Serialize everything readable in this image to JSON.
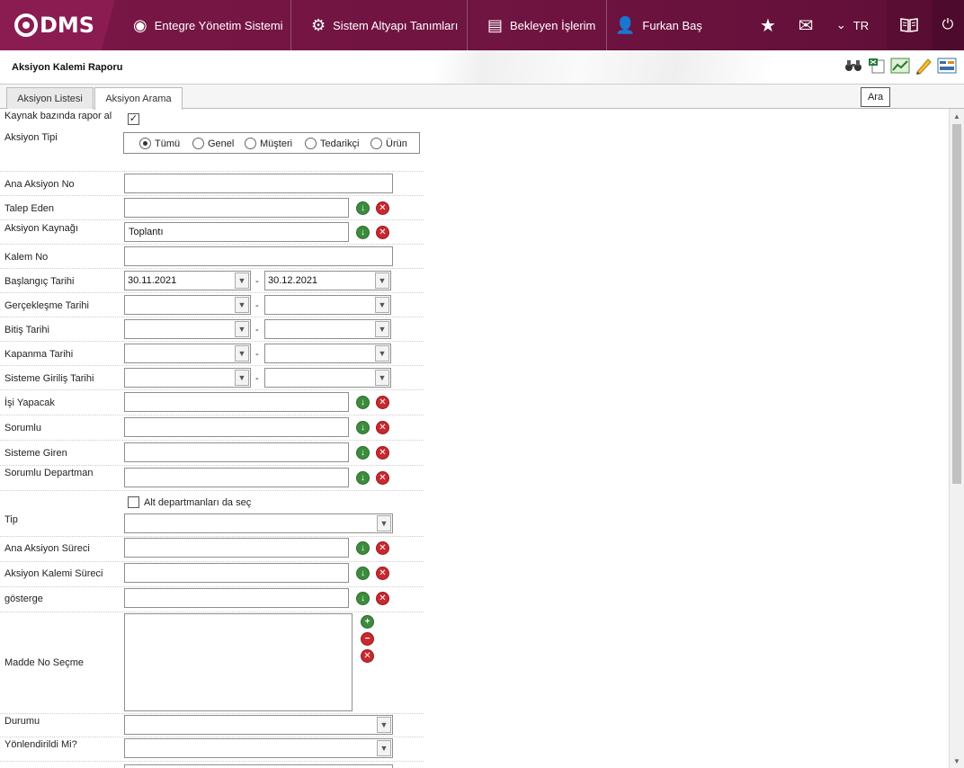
{
  "app": {
    "logo_text": "DMS",
    "nav": [
      {
        "label": "Entegre Yönetim Sistemi",
        "icon": "q-logo-icon"
      },
      {
        "label": "Sistem Altyapı Tanımları",
        "icon": "gear-icon"
      },
      {
        "label": "Bekleyen İşlerim",
        "icon": "clipboard-icon"
      },
      {
        "label": "Furkan Baş",
        "icon": "user-icon"
      }
    ],
    "language": "TR"
  },
  "page": {
    "title": "Aksiyon Kalemi Raporu",
    "tooltip": "Ara",
    "tabs": [
      {
        "label": "Aksiyon Listesi",
        "active": false
      },
      {
        "label": "Aksiyon Arama",
        "active": true
      }
    ]
  },
  "form": {
    "kaynak_bazinda": {
      "label": "Kaynak bazında rapor al",
      "checked": true
    },
    "aksiyon_tipi": {
      "label": "Aksiyon Tipi",
      "options": [
        "Tümü",
        "Genel",
        "Müşteri",
        "Tedarikçi",
        "Ürün"
      ],
      "selected": "Tümü"
    },
    "ana_aksiyon_no": {
      "label": "Ana Aksiyon No",
      "value": ""
    },
    "talep_eden": {
      "label": "Talep Eden",
      "value": ""
    },
    "aksiyon_kaynagi": {
      "label": "Aksiyon Kaynağı",
      "value": "Toplantı"
    },
    "kalem_no": {
      "label": "Kalem No",
      "value": ""
    },
    "baslangic_tarihi": {
      "label": "Başlangıç Tarihi",
      "from": "30.11.2021",
      "to": "30.12.2021"
    },
    "gerceklesme_tarihi": {
      "label": "Gerçekleşme Tarihi",
      "from": "",
      "to": ""
    },
    "bitis_tarihi": {
      "label": "Bitiş Tarihi",
      "from": "",
      "to": ""
    },
    "kapanma_tarihi": {
      "label": "Kapanma Tarihi",
      "from": "",
      "to": ""
    },
    "sisteme_giris_tarihi": {
      "label": "Sisteme Giriliş Tarihi",
      "from": "",
      "to": ""
    },
    "isi_yapacak": {
      "label": "İşi Yapacak",
      "value": ""
    },
    "sorumlu": {
      "label": "Sorumlu",
      "value": ""
    },
    "sisteme_giren": {
      "label": "Sisteme Giren",
      "value": ""
    },
    "sorumlu_departman": {
      "label": "Sorumlu Departman",
      "value": ""
    },
    "alt_departman": {
      "label": "Alt departmanları da seç",
      "checked": false
    },
    "tip": {
      "label": "Tip",
      "value": ""
    },
    "ana_aksiyon_sureci": {
      "label": "Ana Aksiyon Süreci",
      "value": ""
    },
    "aksiyon_kalemi_sureci": {
      "label": "Aksiyon Kalemi Süreci",
      "value": ""
    },
    "gosterge": {
      "label": "gösterge",
      "value": ""
    },
    "madde_no_secme": {
      "label": "Madde No Seçme"
    },
    "durumu": {
      "label": "Durumu",
      "value": ""
    },
    "yonlendirildi_mi": {
      "label": "Yönlendirildi Mi?",
      "value": ""
    },
    "dash": "-"
  },
  "colors": {
    "brand": "#7a1747",
    "add": "#3d8b3d",
    "remove": "#c8282e"
  }
}
